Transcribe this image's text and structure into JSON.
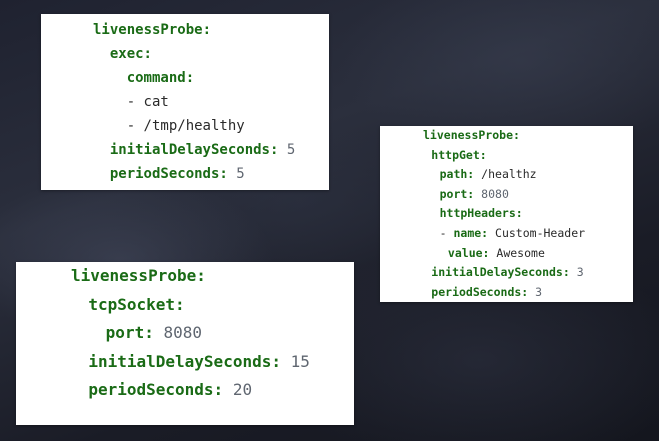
{
  "exec_card": {
    "probe_key": "livenessProbe:",
    "exec_key": "exec:",
    "command_key": "command:",
    "command_items": [
      "- cat",
      "- /tmp/healthy"
    ],
    "initial_delay_key": "initialDelaySeconds:",
    "initial_delay_value": "5",
    "period_key": "periodSeconds:",
    "period_value": "5"
  },
  "http_card": {
    "probe_key": "livenessProbe:",
    "httpget_key": "httpGet:",
    "path_key": "path:",
    "path_value": "/healthz",
    "port_key": "port:",
    "port_value": "8080",
    "headers_key": "httpHeaders:",
    "header_dash": "- ",
    "header_name_key": "name:",
    "header_name_value": "Custom-Header",
    "header_value_key": "value:",
    "header_value_value": "Awesome",
    "initial_delay_key": "initialDelaySeconds:",
    "initial_delay_value": "3",
    "period_key": "periodSeconds:",
    "period_value": "3"
  },
  "tcp_card": {
    "probe_key": "livenessProbe:",
    "tcpsocket_key": "tcpSocket:",
    "port_key": "port:",
    "port_value": "8080",
    "initial_delay_key": "initialDelaySeconds:",
    "initial_delay_value": "15",
    "period_key": "periodSeconds:",
    "period_value": "20"
  }
}
